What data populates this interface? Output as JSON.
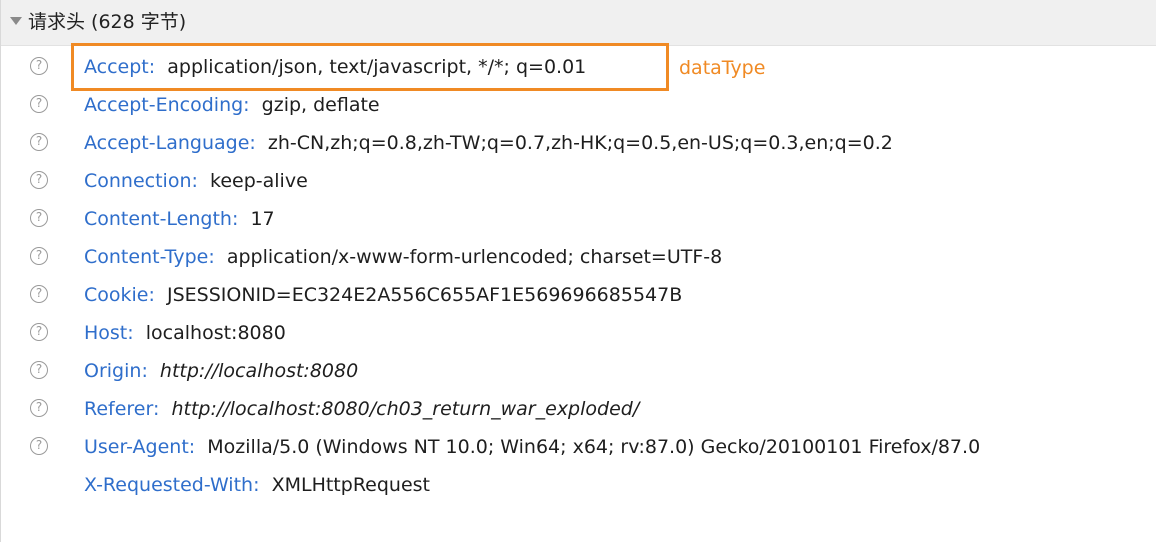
{
  "section": {
    "title": "请求头 (628 字节)",
    "expanded": true,
    "twisty_icon": "triangle-down-icon",
    "help_icon": "question-circle-icon",
    "help_glyph": "?"
  },
  "headers": [
    {
      "name": "Accept",
      "value": "application/json, text/javascript, */*; q=0.01",
      "has_help": true,
      "italic": false
    },
    {
      "name": "Accept-Encoding",
      "value": "gzip, deflate",
      "has_help": true,
      "italic": false
    },
    {
      "name": "Accept-Language",
      "value": "zh-CN,zh;q=0.8,zh-TW;q=0.7,zh-HK;q=0.5,en-US;q=0.3,en;q=0.2",
      "has_help": true,
      "italic": false
    },
    {
      "name": "Connection",
      "value": "keep-alive",
      "has_help": true,
      "italic": false
    },
    {
      "name": "Content-Length",
      "value": "17",
      "has_help": true,
      "italic": false
    },
    {
      "name": "Content-Type",
      "value": "application/x-www-form-urlencoded; charset=UTF-8",
      "has_help": true,
      "italic": false
    },
    {
      "name": "Cookie",
      "value": "JSESSIONID=EC324E2A556C655AF1E569696685547B",
      "has_help": true,
      "italic": false
    },
    {
      "name": "Host",
      "value": "localhost:8080",
      "has_help": true,
      "italic": false
    },
    {
      "name": "Origin",
      "value": "http://localhost:8080",
      "has_help": true,
      "italic": true
    },
    {
      "name": "Referer",
      "value": "http://localhost:8080/ch03_return_war_exploded/",
      "has_help": true,
      "italic": true
    },
    {
      "name": "User-Agent",
      "value": "Mozilla/5.0 (Windows NT 10.0; Win64; x64; rv:87.0) Gecko/20100101 Firefox/87.0",
      "has_help": true,
      "italic": false
    },
    {
      "name": "X-Requested-With",
      "value": "XMLHttpRequest",
      "has_help": false,
      "italic": false
    }
  ],
  "annotation": {
    "label": "dataType",
    "color": "#f08a24"
  },
  "colors": {
    "header_name": "#2f6ecb",
    "header_value": "#1e1e1e",
    "section_bg": "#f0f0f0",
    "help_icon": "#9a9a9a"
  }
}
